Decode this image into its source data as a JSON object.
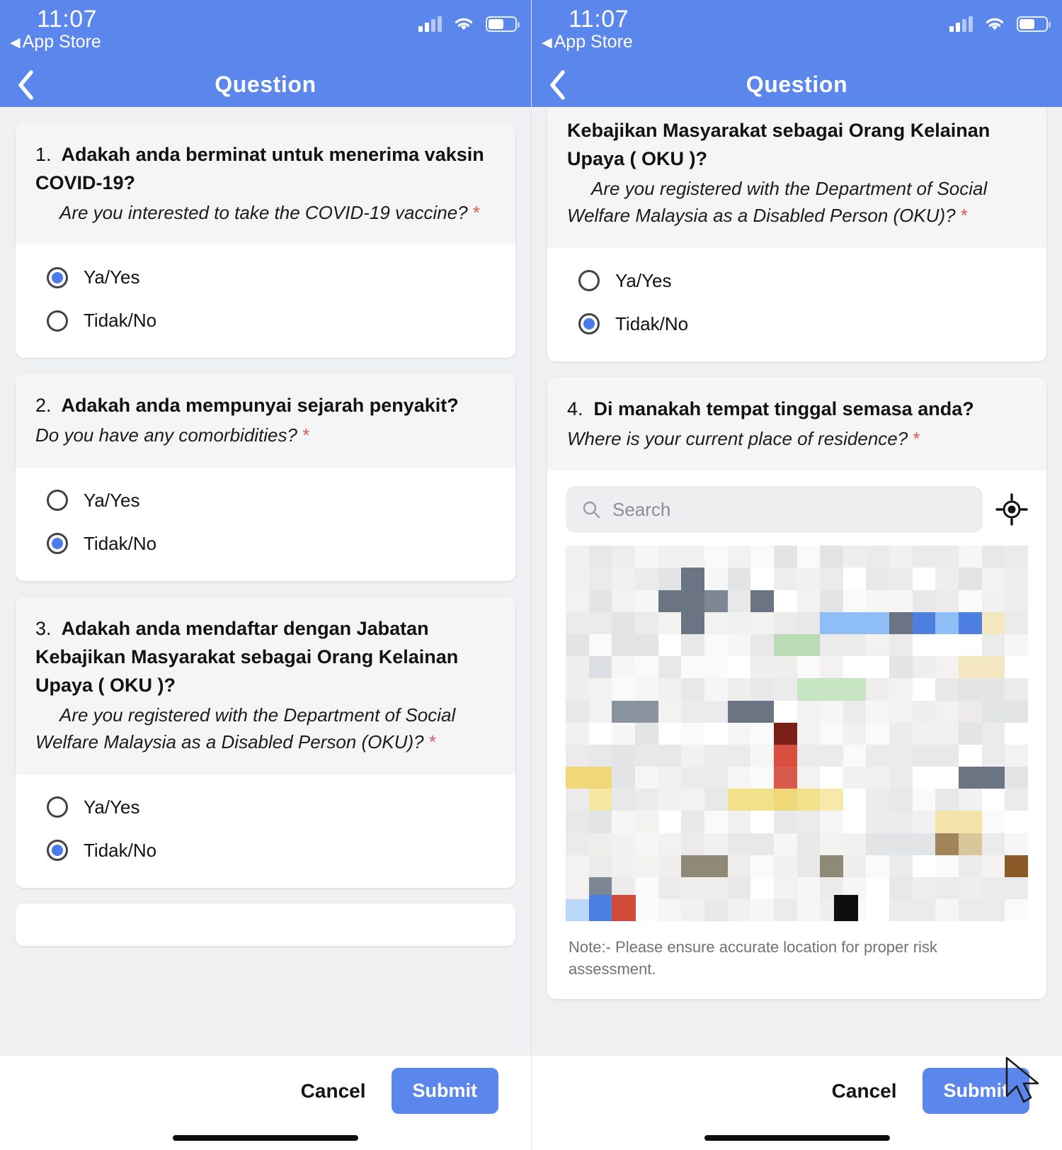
{
  "status_bar": {
    "time": "11:07",
    "back_app": "App Store",
    "back_triangle": "◀",
    "signal_icon": "cellular-bars-icon",
    "wifi_icon": "wifi-icon",
    "battery_icon": "battery-icon"
  },
  "nav": {
    "title": "Question",
    "back_icon": "chevron-left-icon"
  },
  "colors": {
    "accent": "#5b86ec",
    "radio_fill": "#4a7bed",
    "required": "#e05b5b",
    "page_bg": "#eef0f2",
    "card_head_bg": "#f5f5f6"
  },
  "options": {
    "yes": "Ya/Yes",
    "no": "Tidak/No"
  },
  "questions": [
    {
      "number": "1.",
      "my": "Adakah anda berminat untuk menerima vaksin COVID-19?",
      "en": "Are you interested to take the COVID-19 vaccine?",
      "required_mark": "*",
      "selected": "yes"
    },
    {
      "number": "2.",
      "my": "Adakah anda mempunyai sejarah penyakit?",
      "en": "Do you have any comorbidities?",
      "required_mark": "*",
      "selected": "no"
    },
    {
      "number": "3.",
      "my": "Adakah anda mendaftar dengan Jabatan Kebajikan Masyarakat sebagai Orang Kelainan Upaya ( OKU )?",
      "en": "Are you registered with the Department of Social Welfare Malaysia as a Disabled Person (OKU)?",
      "required_mark": "*",
      "selected": "no"
    },
    {
      "number": "4.",
      "my": "Di manakah tempat tinggal semasa anda?",
      "en": "Where is your current place of residence?",
      "required_mark": "*",
      "selected": null
    }
  ],
  "right_panel": {
    "partial_question_my": "Kebajikan Masyarakat sebagai Orang Kelainan Upaya ( OKU )?",
    "partial_question_en": "Are you registered with the Department of Social Welfare Malaysia as a Disabled Person (OKU)?",
    "required_mark": "*"
  },
  "map_question": {
    "search_placeholder": "Search",
    "search_value": "",
    "search_icon": "search-icon",
    "locate_icon": "locate-me-icon",
    "note": "Note:- Please ensure accurate location for proper risk assessment."
  },
  "footer": {
    "cancel_label": "Cancel",
    "submit_label": "Submit"
  }
}
